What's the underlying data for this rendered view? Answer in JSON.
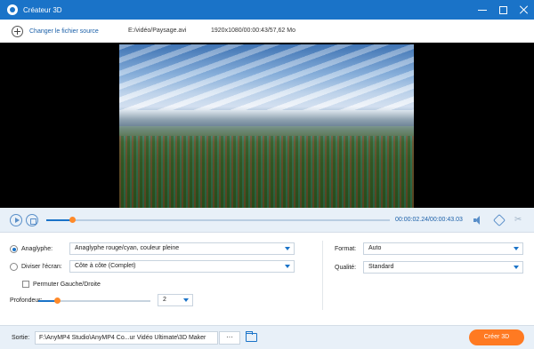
{
  "window": {
    "title": "Créateur 3D"
  },
  "source": {
    "change_label": "Changer le fichier source",
    "file_path": "E:/vidéo/Paysage.avi",
    "file_info": "1920x1080/00:00:43/57,62 Mo"
  },
  "player": {
    "time": "00:00:02.24/00:00:43.03",
    "progress_fraction": 0.076
  },
  "settings": {
    "anaglyph": {
      "label": "Anaglyphe:",
      "selected": true,
      "value": "Anaglyphe rouge/cyan, couleur pleine"
    },
    "split": {
      "label": "Diviser l'écran:",
      "selected": false,
      "value": "Côte à côte (Complet)"
    },
    "swap": {
      "label": "Permuter Gauche/Droite",
      "checked": false
    },
    "depth": {
      "label": "Profondeur:",
      "value": "2",
      "slider_fraction": 0.17
    },
    "format": {
      "label": "Format:",
      "value": "Auto"
    },
    "quality": {
      "label": "Qualité:",
      "value": "Standard"
    }
  },
  "output": {
    "label": "Sortie:",
    "path": "F:\\AnyMP4 Studio\\AnyMP4 Co...ur Vidéo Ultimate\\3D Maker",
    "more_label": "···",
    "create_label": "Créer 3D"
  },
  "colors": {
    "accent": "#1a73c8",
    "cta": "#ff7a22"
  }
}
